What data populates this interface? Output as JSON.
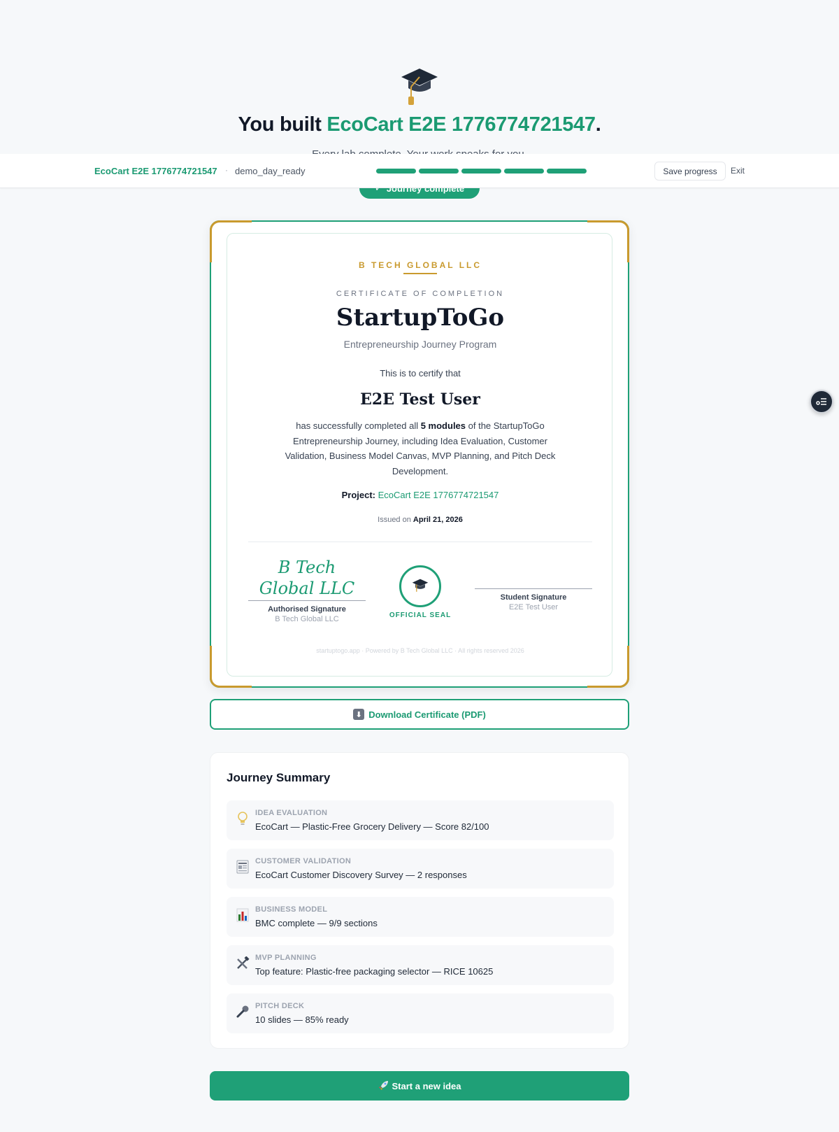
{
  "hero": {
    "title_prefix": "You built ",
    "title_project": "EcoCart E2E 1776774721547",
    "title_suffix": ".",
    "subtitle": "Every lab complete. Your work speaks for you.",
    "badge": "Journey complete"
  },
  "topbar": {
    "project_name": "EcoCart E2E 1776774721547",
    "separator": "·",
    "stage": "demo_day_ready",
    "progress_completed": 5,
    "progress_total": 5,
    "save_label": "Save progress",
    "exit_label": "Exit"
  },
  "certificate": {
    "issuer": "B TECH GLOBAL LLC",
    "type": "CERTIFICATE OF COMPLETION",
    "program": "StartupToGo",
    "program_sub": "Entrepreneurship Journey Program",
    "certify_text": "This is to certify that",
    "recipient": "E2E Test User",
    "body_pre": "has successfully completed all ",
    "body_bold": "5 modules",
    "body_post": " of the StartupToGo Entrepreneurship Journey, including Idea Evaluation, Customer Validation, Business Model Canvas, MVP Planning, and Pitch Deck Development.",
    "project_label": "Project: ",
    "project_value": "EcoCart E2E 1776774721547",
    "issued_label": "Issued on ",
    "issued_date": "April 21, 2026",
    "signature_script": "B Tech Global LLC",
    "authorised_label": "Authorised Signature",
    "authorised_name": "B Tech Global LLC",
    "seal_label": "OFFICIAL SEAL",
    "student_label": "Student Signature",
    "student_name": "E2E Test User",
    "footer": "startuptogo.app · Powered by B Tech Global LLC · All rights reserved 2026"
  },
  "download_label": "Download Certificate (PDF)",
  "summary": {
    "title": "Journey Summary",
    "items": [
      {
        "icon": "lightbulb-icon",
        "label": "IDEA EVALUATION",
        "value": "EcoCart — Plastic-Free Grocery Delivery — Score 82/100"
      },
      {
        "icon": "newspaper-icon",
        "label": "CUSTOMER VALIDATION",
        "value": "EcoCart Customer Discovery Survey — 2 responses"
      },
      {
        "icon": "bar-chart-icon",
        "label": "BUSINESS MODEL",
        "value": "BMC complete — 9/9 sections"
      },
      {
        "icon": "tools-icon",
        "label": "MVP PLANNING",
        "value": "Top feature: Plastic-free packaging selector — RICE 10625"
      },
      {
        "icon": "microphone-icon",
        "label": "PITCH DECK",
        "value": "10 slides — 85% ready"
      }
    ]
  },
  "start_label": "Start a new idea",
  "colors": {
    "accent": "#1fa077",
    "gold": "#c99a2e"
  }
}
